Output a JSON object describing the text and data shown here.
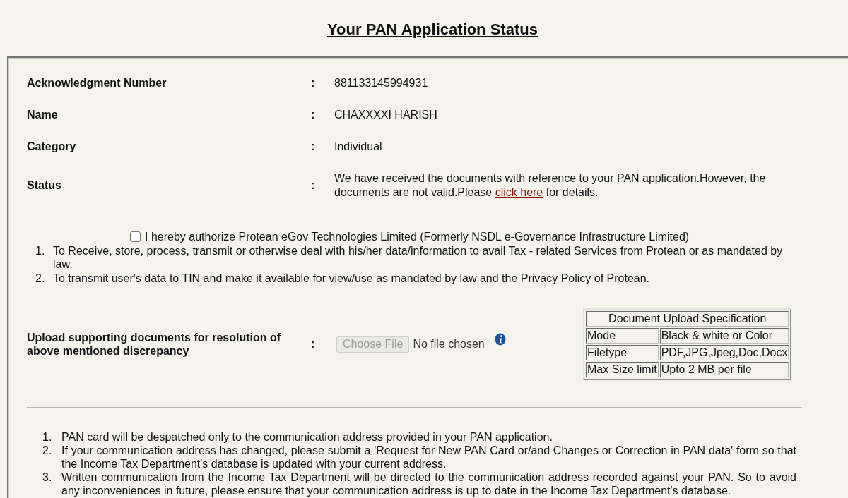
{
  "title": "Your PAN Application Status",
  "details": [
    {
      "kind": "text",
      "label": "Acknowledgment Number",
      "separator": ":",
      "value": "881133145994931"
    },
    {
      "kind": "text",
      "label": "Name",
      "separator": ":",
      "value": "CHAXXXXI HARISH"
    },
    {
      "kind": "text",
      "label": "Category",
      "separator": ":",
      "value": "Individual"
    },
    {
      "kind": "status",
      "label": "Status",
      "separator": ":",
      "value": "We have received the documents with reference to your PAN application.However, the documents are not valid.Please",
      "link": "click here",
      "value_after": "for details."
    }
  ],
  "consent": {
    "checked": false,
    "label": "I hereby authorize Protean eGov Technologies Limited (Formerly NSDL e-Governance Infrastructure Limited)",
    "items": [
      {
        "number": "1.",
        "text": "To Receive, store, process, transmit or otherwise deal with his/her data/information to avail Tax - related Services from Protean or as mandated by law."
      },
      {
        "number": "2.",
        "text": "To transmit user's data to TIN and make it available for view/use as mandated by law and the Privacy Policy of Protean."
      }
    ]
  },
  "upload": {
    "label": "Upload supporting documents for resolution of above mentioned discrepancy",
    "separator": ":",
    "button": "Choose File",
    "disabled": true,
    "file_status": "No file chosen"
  },
  "spec_table": {
    "title": "Document Upload Specification",
    "rows": [
      {
        "field": "Mode",
        "value": "Black & white or Color"
      },
      {
        "field": "Filetype",
        "value": "PDF,JPG,Jpeg,Doc,Docx"
      },
      {
        "field": "Max Size limit",
        "value": "Upto 2 MB per file"
      }
    ]
  },
  "notes": [
    {
      "number": "1.",
      "text": "PAN card will be despatched only to the communication address provided in your PAN application."
    },
    {
      "number": "2.",
      "text": "If your communication address has changed, please submit a 'Request for New PAN Card or/and Changes or Correction in PAN data' form so that the Income Tax Department's database is updated with your current address."
    },
    {
      "number": "3.",
      "text": "Written communication from the Income Tax Department will be directed to the communication address recorded against your PAN. So to avoid any inconveniences in future, please ensure that your communication address is up to date in the Income Tax Department's database."
    }
  ]
}
